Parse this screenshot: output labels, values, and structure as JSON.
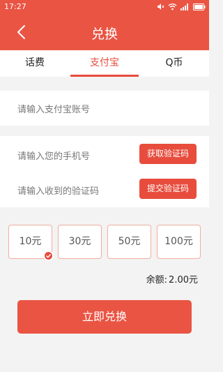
{
  "status_bar": {
    "time": "17:27"
  },
  "header": {
    "title": "兑换"
  },
  "tabs": [
    {
      "label": "话费",
      "active": false
    },
    {
      "label": "支付宝",
      "active": true
    },
    {
      "label": "Q币",
      "active": false
    }
  ],
  "form": {
    "alipay_placeholder": "请输入支付宝账号",
    "phone_placeholder": "请输入您的手机号",
    "get_code_label": "获取验证码",
    "code_placeholder": "请输入收到的验证码",
    "submit_code_label": "提交验证码"
  },
  "amounts": [
    {
      "label": "10元",
      "selected": true
    },
    {
      "label": "30元",
      "selected": false
    },
    {
      "label": "50元",
      "selected": false
    },
    {
      "label": "100元",
      "selected": false
    }
  ],
  "balance": {
    "label": "余额:",
    "value": "2.00元"
  },
  "primary_button": {
    "label": "立即兑换"
  },
  "colors": {
    "brand": "#ea5443",
    "accent": "#e84c3d",
    "amount_border": "#f0ad9f",
    "background": "#f3f3f3"
  }
}
